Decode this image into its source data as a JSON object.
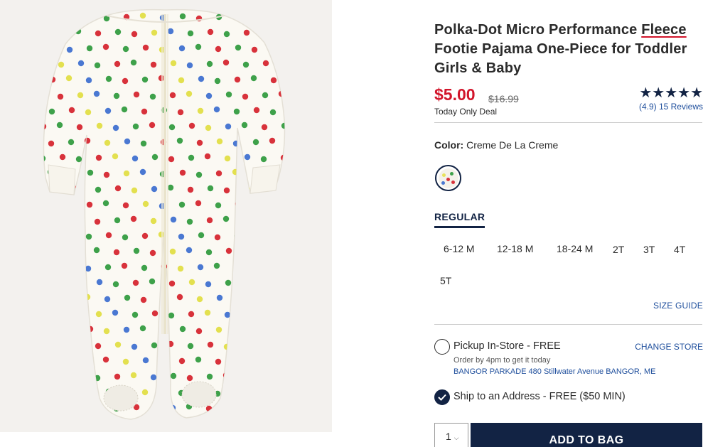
{
  "product": {
    "title_part1": "Polka-Dot Micro Performance ",
    "title_highlight": "Fleece",
    "title_part2": " Footie Pajama One-Piece for Toddler Girls & Baby",
    "image_alt": "Polka-dot footie pajama one-piece"
  },
  "pricing": {
    "price": "$5.00",
    "original_price": "$16.99",
    "deal_text": "Today Only Deal",
    "accent_color": "#d2152b"
  },
  "rating": {
    "stars": "★★★★★",
    "value": 4.9,
    "reviews_text": "(4.9) 15 Reviews"
  },
  "color": {
    "label": "Color:",
    "value": "Creme De La Creme"
  },
  "sizes": {
    "tab_label": "REGULAR",
    "options": [
      "6-12 M",
      "12-18 M",
      "18-24 M",
      "2T",
      "3T",
      "4T",
      "5T"
    ],
    "size_guide": "SIZE GUIDE"
  },
  "fulfillment": {
    "pickup_label": "Pickup In-Store - FREE",
    "pickup_sub": "Order by 4pm to get it today",
    "store_line": "BANGOR PARKADE 480 Stillwater Avenue  BANGOR, ME",
    "change_store": "CHANGE STORE",
    "ship_label": "Ship to an Address - FREE ($50 MIN)",
    "ship_selected": true
  },
  "cart": {
    "quantity": "1",
    "add_button": "ADD TO BAG",
    "brand_color": "#122344"
  }
}
